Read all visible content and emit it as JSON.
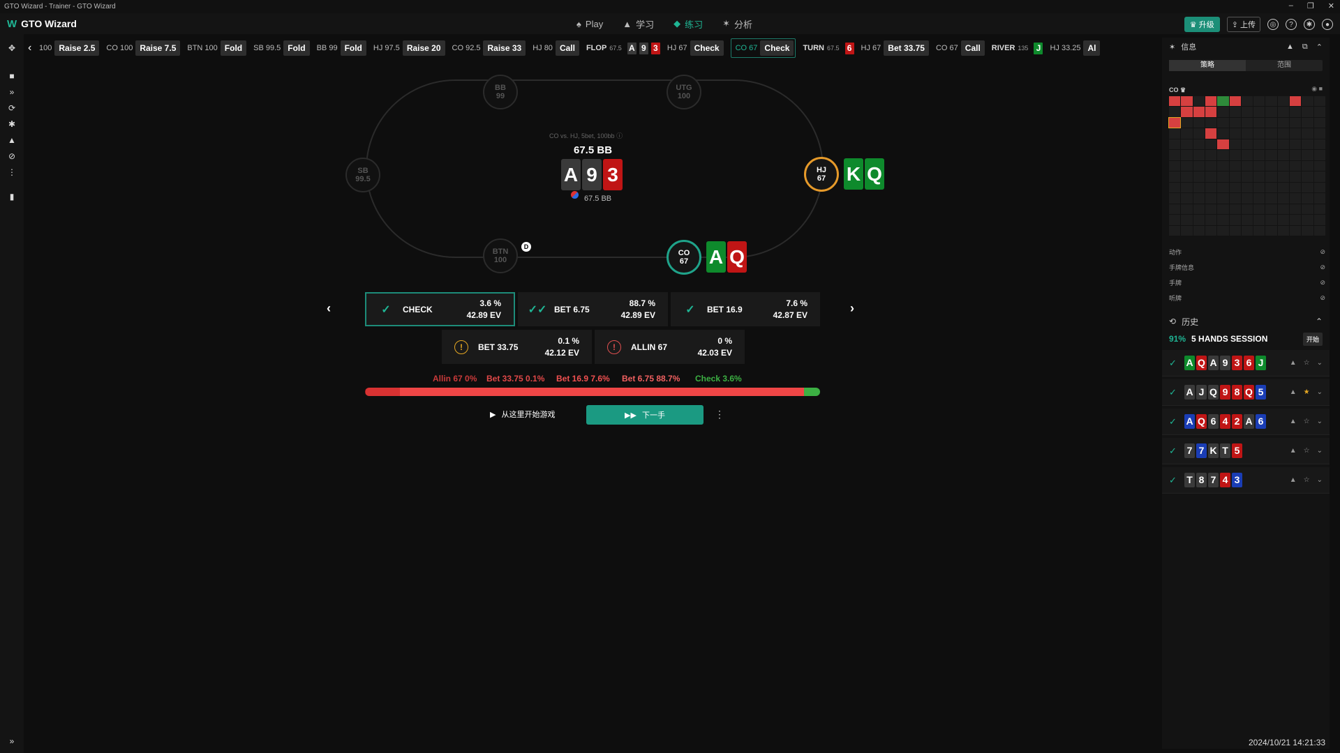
{
  "window": {
    "title": "GTO Wizard - Trainer - GTO Wizard",
    "controls": [
      "–",
      "❐",
      "✕"
    ]
  },
  "app": {
    "name": "GTO Wizard",
    "nav": [
      {
        "label": "Play",
        "icon": "spade-icon"
      },
      {
        "label": "学习",
        "icon": "study-icon"
      },
      {
        "label": "练习",
        "icon": "practice-icon",
        "active": true
      },
      {
        "label": "分析",
        "icon": "bulb-icon"
      }
    ],
    "upgrade": "升级",
    "upload": "上传"
  },
  "action_bar": [
    {
      "pos": "100",
      "act": "Raise 2.5"
    },
    {
      "pos": "CO 100",
      "act": "Raise 7.5"
    },
    {
      "pos": "BTN 100",
      "act": "Fold"
    },
    {
      "pos": "SB 99.5",
      "act": "Fold"
    },
    {
      "pos": "BB 99",
      "act": "Fold"
    },
    {
      "pos": "HJ 97.5",
      "act": "Raise 20"
    },
    {
      "pos": "CO 92.5",
      "act": "Raise 33"
    },
    {
      "pos": "HJ 80",
      "act": "Call"
    },
    {
      "street": "FLOP",
      "pot": "67.5",
      "cards": [
        {
          "r": "A",
          "c": "gray"
        },
        {
          "r": "9",
          "c": "gray"
        },
        {
          "r": "3",
          "c": "red"
        }
      ]
    },
    {
      "pos": "HJ 67",
      "act": "Check"
    },
    {
      "pos": "CO 67",
      "act": "Check",
      "hl": true
    },
    {
      "street": "TURN",
      "pot": "67.5",
      "cards": [
        {
          "r": "6",
          "c": "red"
        }
      ]
    },
    {
      "pos": "HJ 67",
      "act": "Bet 33.75"
    },
    {
      "pos": "CO 67",
      "act": "Call"
    },
    {
      "street": "RIVER",
      "pot": "135",
      "cards": [
        {
          "r": "J",
          "c": "green"
        }
      ]
    },
    {
      "pos": "HJ 33.25",
      "act": "Al"
    }
  ],
  "table": {
    "info": "CO vs. HJ, 5bet, 100bb",
    "pot": "67.5 BB",
    "pot_small": "67.5 BB",
    "board": [
      {
        "r": "A",
        "c": "gray"
      },
      {
        "r": "9",
        "c": "gray"
      },
      {
        "r": "3",
        "c": "red"
      }
    ],
    "dealer": "D",
    "seats": {
      "bb": {
        "pos": "BB",
        "stack": "99"
      },
      "utg": {
        "pos": "UTG",
        "stack": "100"
      },
      "sb": {
        "pos": "SB",
        "stack": "99.5"
      },
      "btn": {
        "pos": "BTN",
        "stack": "100"
      },
      "hj": {
        "pos": "HJ",
        "stack": "67"
      },
      "co": {
        "pos": "CO",
        "stack": "67"
      }
    },
    "hj_cards": [
      {
        "r": "K",
        "c": "green"
      },
      {
        "r": "Q",
        "c": "green"
      }
    ],
    "co_cards": [
      {
        "r": "A",
        "c": "green"
      },
      {
        "r": "Q",
        "c": "red"
      }
    ]
  },
  "options": {
    "check": {
      "label": "CHECK",
      "freq": "3.6 %",
      "ev": "42.89 EV"
    },
    "bet675": {
      "label": "BET 6.75",
      "freq": "88.7 %",
      "ev": "42.89 EV"
    },
    "bet169": {
      "label": "BET 16.9",
      "freq": "7.6 %",
      "ev": "42.87 EV"
    },
    "bet3375": {
      "label": "BET 33.75",
      "freq": "0.1 %",
      "ev": "42.12 EV"
    },
    "allin": {
      "label": "ALLIN 67",
      "freq": "0 %",
      "ev": "42.03 EV"
    }
  },
  "freq_legend": [
    {
      "text": "Allin 67  0%",
      "color": "#c83a3a"
    },
    {
      "text": "Bet 33.75  0.1%",
      "color": "#e04848"
    },
    {
      "text": "Bet 16.9  7.6%",
      "color": "#f05050"
    },
    {
      "text": "Bet 6.75  88.7%",
      "color": "#f06060"
    },
    {
      "text": "Check  3.6%",
      "color": "#3cb043"
    }
  ],
  "freq_bar": [
    {
      "pct": 0.1,
      "color": "#b02020"
    },
    {
      "pct": 7.6,
      "color": "#d83232"
    },
    {
      "pct": 88.7,
      "color": "#ef4646"
    },
    {
      "pct": 3.6,
      "color": "#3cb043"
    }
  ],
  "controls": {
    "play_from": "从这里开始游戏",
    "next": "下一手"
  },
  "right": {
    "info_title": "信息",
    "tabs": [
      "策略",
      "范围"
    ],
    "range_pos": "CO",
    "toggles": [
      "动作",
      "手牌信息",
      "手牌",
      "听牌"
    ],
    "history_title": "历史",
    "session_pct": "91%",
    "session_label": "5 HANDS SESSION",
    "session_end": "开始",
    "hands": [
      {
        "cards": [
          {
            "r": "A",
            "c": "green"
          },
          {
            "r": "Q",
            "c": "red"
          },
          {
            "r": "A",
            "c": "gray"
          },
          {
            "r": "9",
            "c": "gray"
          },
          {
            "r": "3",
            "c": "red"
          },
          {
            "r": "6",
            "c": "red"
          },
          {
            "r": "J",
            "c": "green"
          }
        ],
        "star": false
      },
      {
        "cards": [
          {
            "r": "A",
            "c": "gray"
          },
          {
            "r": "J",
            "c": "gray"
          },
          {
            "r": "Q",
            "c": "gray"
          },
          {
            "r": "9",
            "c": "red"
          },
          {
            "r": "8",
            "c": "red"
          },
          {
            "r": "Q",
            "c": "red"
          },
          {
            "r": "5",
            "c": "blue"
          }
        ],
        "star": true
      },
      {
        "cards": [
          {
            "r": "A",
            "c": "blue"
          },
          {
            "r": "Q",
            "c": "red"
          },
          {
            "r": "6",
            "c": "gray"
          },
          {
            "r": "4",
            "c": "red"
          },
          {
            "r": "2",
            "c": "red"
          },
          {
            "r": "A",
            "c": "gray"
          },
          {
            "r": "6",
            "c": "blue"
          }
        ],
        "star": false
      },
      {
        "cards": [
          {
            "r": "7",
            "c": "gray"
          },
          {
            "r": "7",
            "c": "blue"
          },
          {
            "r": "K",
            "c": "gray"
          },
          {
            "r": "T",
            "c": "gray"
          },
          {
            "r": "5",
            "c": "red"
          }
        ],
        "star": false
      },
      {
        "cards": [
          {
            "r": "T",
            "c": "gray"
          },
          {
            "r": "8",
            "c": "gray"
          },
          {
            "r": "7",
            "c": "gray"
          },
          {
            "r": "4",
            "c": "red"
          },
          {
            "r": "3",
            "c": "blue"
          }
        ],
        "star": false
      }
    ]
  },
  "timestamp": "2024/10/21 14:21:33"
}
